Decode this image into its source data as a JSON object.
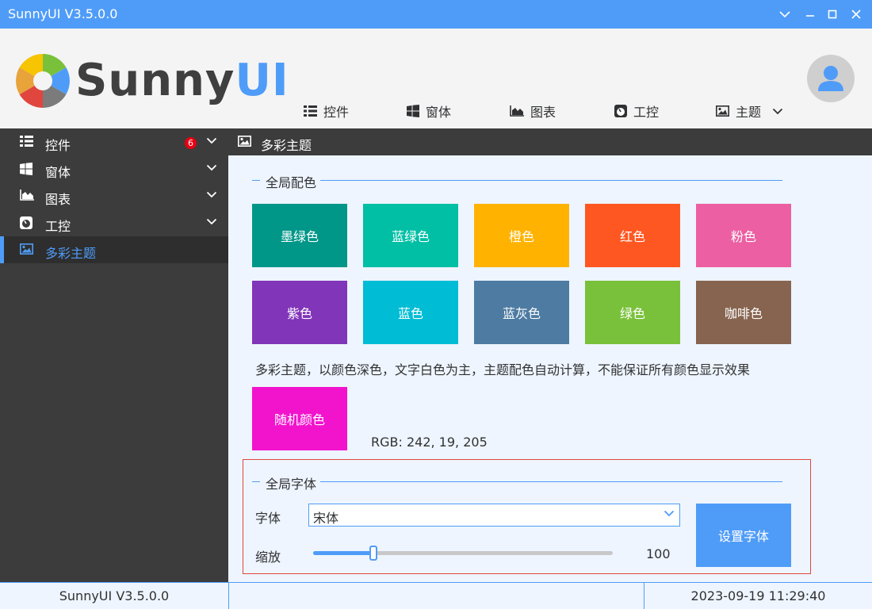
{
  "window": {
    "title": "SunnyUI V3.5.0.0"
  },
  "header": {
    "logo_text_main": "Sunny",
    "logo_text_accent": "UI",
    "nav": [
      {
        "label": "控件",
        "icon": "list-icon"
      },
      {
        "label": "窗体",
        "icon": "windows-icon"
      },
      {
        "label": "图表",
        "icon": "area-chart-icon"
      },
      {
        "label": "工控",
        "icon": "gauge-icon"
      },
      {
        "label": "主题",
        "icon": "image-icon"
      }
    ]
  },
  "sidebar": {
    "items": [
      {
        "label": "控件",
        "icon": "list-icon",
        "badge": "6"
      },
      {
        "label": "窗体",
        "icon": "windows-icon"
      },
      {
        "label": "图表",
        "icon": "area-chart-icon"
      },
      {
        "label": "工控",
        "icon": "gauge-icon"
      },
      {
        "label": "多彩主题",
        "icon": "image-icon",
        "active": true
      }
    ]
  },
  "content": {
    "header_title": "多彩主题",
    "color_section_title": "全局配色",
    "color_buttons": [
      {
        "label": "墨绿色",
        "color": "#009688"
      },
      {
        "label": "蓝绿色",
        "color": "#00BFA5"
      },
      {
        "label": "橙色",
        "color": "#FFB300"
      },
      {
        "label": "红色",
        "color": "#FF5722"
      },
      {
        "label": "粉色",
        "color": "#EC5FA2"
      },
      {
        "label": "紫色",
        "color": "#8135B9"
      },
      {
        "label": "蓝色",
        "color": "#00BCD4"
      },
      {
        "label": "蓝灰色",
        "color": "#4D7BA2"
      },
      {
        "label": "绿色",
        "color": "#7AC13B"
      },
      {
        "label": "咖啡色",
        "color": "#87644F"
      }
    ],
    "description": "多彩主题，以颜色深色，文字白色为主，主题配色自动计算，不能保证所有颜色显示效果",
    "random_button": {
      "label": "随机颜色",
      "color": "#F213CD"
    },
    "rgb_text": "RGB: 242, 19, 205",
    "font_section_title": "全局字体",
    "font_label": "字体",
    "font_value": "宋体",
    "zoom_label": "缩放",
    "zoom_value": "100",
    "zoom_fraction": 0.2,
    "set_font_button": "设置字体"
  },
  "statusbar": {
    "version": "SunnyUI V3.5.0.0",
    "middle": "",
    "datetime": "2023-09-19 11:29:40"
  },
  "colors": {
    "accent": "#4F9CF8",
    "sidebar_bg": "#3C3C3C",
    "badge": "#E60012",
    "highlight_border": "#E0463E"
  }
}
